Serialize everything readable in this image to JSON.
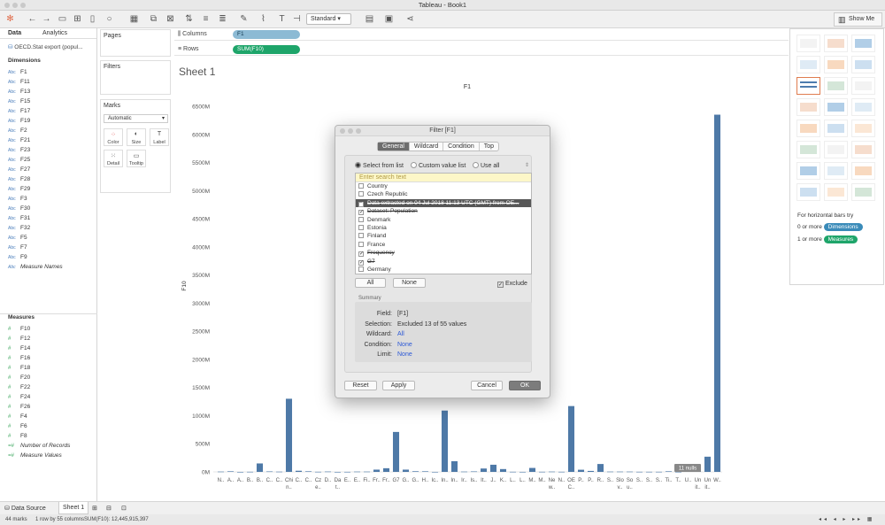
{
  "window": {
    "title": "Tableau - Book1"
  },
  "toolbar": {
    "mark_size_select": "Standard",
    "show_me_label": "Show Me"
  },
  "data_pane": {
    "tabs": [
      "Data",
      "Analytics"
    ],
    "datasource": "OECD.Stat export (popul...",
    "dimensions_header": "Dimensions",
    "dimensions": [
      "F1",
      "F11",
      "F13",
      "F15",
      "F17",
      "F19",
      "F2",
      "F21",
      "F23",
      "F25",
      "F27",
      "F28",
      "F29",
      "F3",
      "F30",
      "F31",
      "F32",
      "F5",
      "F7",
      "F9",
      "Measure Names"
    ],
    "measures_header": "Measures",
    "measures": [
      "F10",
      "F12",
      "F14",
      "F16",
      "F18",
      "F20",
      "F22",
      "F24",
      "F26",
      "F4",
      "F6",
      "F8",
      "Number of Records",
      "Measure Values"
    ]
  },
  "cards": {
    "pages": "Pages",
    "filters": "Filters",
    "marks": "Marks",
    "marks_type": "Automatic",
    "mark_buttons": [
      "Color",
      "Size",
      "Label",
      "Detail",
      "Tooltip"
    ]
  },
  "shelves": {
    "columns_label": "Columns",
    "columns_pill": "F1",
    "rows_label": "Rows",
    "rows_pill": "SUM(F10)"
  },
  "sheet": {
    "title": "Sheet 1",
    "tooltip_badge": "11 nulls"
  },
  "chart_data": {
    "type": "bar",
    "title": "F1",
    "ylabel": "F10",
    "xlabel": "",
    "ylim": [
      0,
      6500000000
    ],
    "yticks": [
      "0M",
      "500M",
      "1000M",
      "1500M",
      "2000M",
      "2500M",
      "3000M",
      "3500M",
      "4000M",
      "4500M",
      "5000M",
      "5500M",
      "6000M",
      "6500M"
    ],
    "categories": [
      "N..",
      "A..",
      "A..",
      "B..",
      "B..",
      "C..",
      "C..",
      "Chi\nn..",
      "C..",
      "C..",
      "Cz\ne..",
      "D..",
      "Da\nt..",
      "E..",
      "E..",
      "Fi..",
      "Fr..",
      "Fr..",
      "G7",
      "G..",
      "G..",
      "H..",
      "Ic..",
      "In..",
      "In..",
      "Ir..",
      "Is..",
      "It..",
      "J..",
      "K..",
      "L..",
      "L..",
      "M..",
      "M..",
      "Ne\nw..",
      "N..",
      "OE\nC..",
      "P..",
      "P..",
      "R..",
      "S..",
      "Slo\nv..",
      "So\nu..",
      "S..",
      "S..",
      "S..",
      "Ti..",
      "T..",
      "U..",
      "Un\nit..",
      "Un\nit..",
      "W.."
    ],
    "values": [
      5000000,
      10000000,
      0,
      2000000,
      150000000,
      8000000,
      4000000,
      1300000000,
      20000000,
      10000000,
      2000000,
      6000000,
      0,
      1000000,
      5000000,
      5000000,
      40000000,
      65000000,
      710000000,
      40000000,
      11000000,
      10000000,
      300000,
      1090000000,
      190000000,
      5000000,
      8000000,
      60000000,
      127000000,
      50000000,
      2000000,
      500000,
      70000000,
      2000000,
      5000000,
      2000000,
      1170000000,
      38000000,
      17000000,
      140000000,
      5000000,
      5000000,
      5000000,
      2000000,
      2000000,
      2000000,
      10000000,
      1000000,
      80000000,
      65000000,
      270000000,
      6350000000
    ],
    "grid": false
  },
  "showme": {
    "hint_text": "For horizontal bars try",
    "dimensions_line": "0 or more",
    "dimensions_pill": "Dimensions",
    "measures_line": "1 or more",
    "measures_pill": "Measures"
  },
  "bottom": {
    "tabs": [
      "Data Source",
      "Sheet 1"
    ],
    "status_marks": "44 marks",
    "status_rows": "1 row by 55 columns",
    "status_sum": "SUM(F10): 12,445,915,397"
  },
  "filter_dialog": {
    "title": "Filter [F1]",
    "tabs": [
      "General",
      "Wildcard",
      "Condition",
      "Top"
    ],
    "radio_options": [
      "Select from list",
      "Custom value list",
      "Use all"
    ],
    "search_placeholder": "Enter search text",
    "items": [
      {
        "label": "Country",
        "checked": false,
        "strike": false,
        "highlight": false
      },
      {
        "label": "Czech Republic",
        "checked": false,
        "strike": false,
        "highlight": false
      },
      {
        "label": "Data extracted on 04 Jul 2018 11:13 UTC (GMT) from OE...",
        "checked": true,
        "strike": true,
        "highlight": true
      },
      {
        "label": "Dataset: Population",
        "checked": true,
        "strike": true,
        "highlight": false
      },
      {
        "label": "Denmark",
        "checked": false,
        "strike": false,
        "highlight": false
      },
      {
        "label": "Estonia",
        "checked": false,
        "strike": false,
        "highlight": false
      },
      {
        "label": "Finland",
        "checked": false,
        "strike": false,
        "highlight": false
      },
      {
        "label": "France",
        "checked": false,
        "strike": false,
        "highlight": false
      },
      {
        "label": "Frequency",
        "checked": true,
        "strike": true,
        "highlight": false
      },
      {
        "label": "G7",
        "checked": true,
        "strike": true,
        "highlight": false
      },
      {
        "label": "Germany",
        "checked": false,
        "strike": false,
        "highlight": false
      }
    ],
    "all_btn": "All",
    "none_btn": "None",
    "exclude_label": "Exclude",
    "summary_header": "Summary",
    "summary": [
      {
        "k": "Field:",
        "v": "[F1]",
        "link": false
      },
      {
        "k": "Selection:",
        "v": "Excluded 13 of 55 values",
        "link": false
      },
      {
        "k": "Wildcard:",
        "v": "All",
        "link": true
      },
      {
        "k": "Condition:",
        "v": "None",
        "link": true
      },
      {
        "k": "Limit:",
        "v": "None",
        "link": true
      }
    ],
    "reset_btn": "Reset",
    "apply_btn": "Apply",
    "cancel_btn": "Cancel",
    "ok_btn": "OK"
  }
}
